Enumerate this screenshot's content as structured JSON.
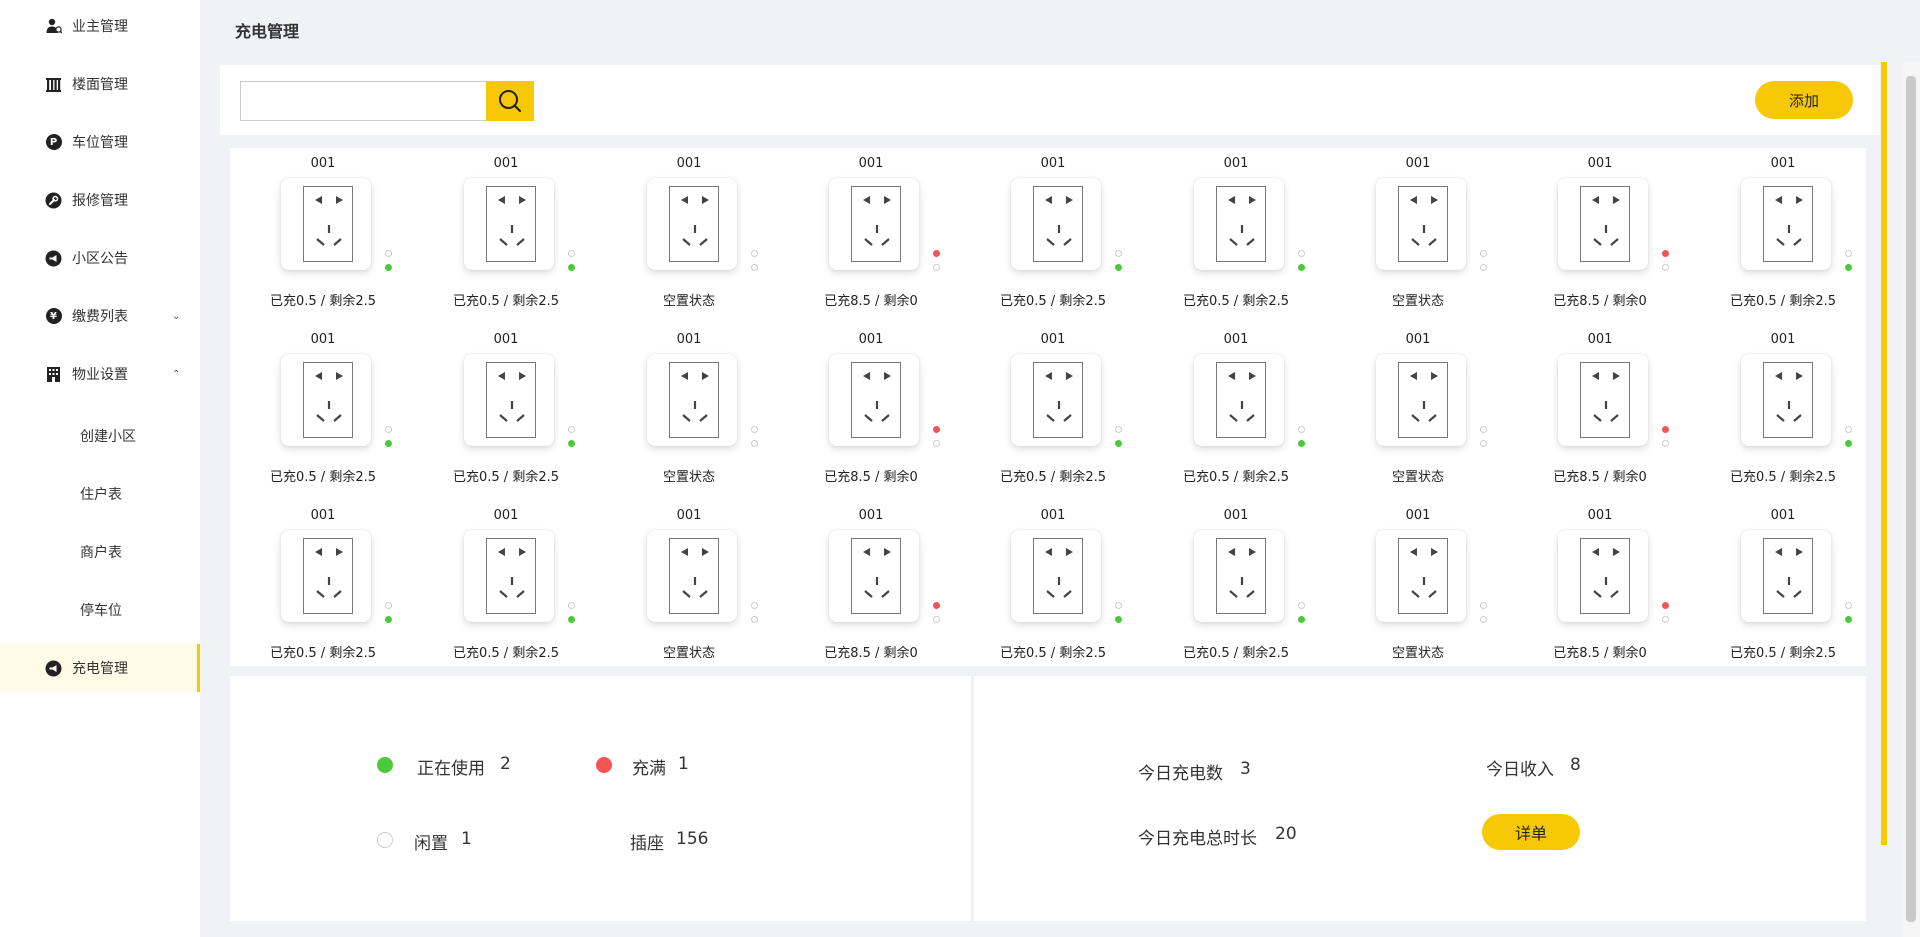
{
  "sidebar": {
    "items": [
      {
        "label": "业主管理",
        "icon": "user-icon"
      },
      {
        "label": "楼面管理",
        "icon": "building-icon"
      },
      {
        "label": "车位管理",
        "icon": "parking-icon",
        "glyph": "P"
      },
      {
        "label": "报修管理",
        "icon": "wrench-icon"
      },
      {
        "label": "小区公告",
        "icon": "megaphone-icon"
      },
      {
        "label": "缴费列表",
        "icon": "yen-icon",
        "glyph": "¥",
        "chevron": "⌄"
      },
      {
        "label": "物业设置",
        "icon": "office-icon",
        "chevron": "⌃"
      }
    ],
    "sub_items": [
      "创建小区",
      "住户表",
      "商户表",
      "停车位"
    ],
    "active": {
      "label": "充电管理",
      "icon": "megaphone-icon"
    }
  },
  "page_title": "充电管理",
  "toolbar": {
    "search_value": "",
    "add_label": "添加"
  },
  "grid": {
    "rows": [
      [
        {
          "num": "001",
          "status": "已充0.5  /  剩余2.5",
          "state": "in-use"
        },
        {
          "num": "001",
          "status": "已充0.5  /  剩余2.5",
          "state": "in-use"
        },
        {
          "num": "001",
          "status": "空置状态",
          "state": "idle"
        },
        {
          "num": "001",
          "status": "已充8.5  /  剩余0",
          "state": "full"
        },
        {
          "num": "001",
          "status": "已充0.5  /  剩余2.5",
          "state": "in-use"
        },
        {
          "num": "001",
          "status": "已充0.5  /  剩余2.5",
          "state": "in-use"
        },
        {
          "num": "001",
          "status": "空置状态",
          "state": "idle"
        },
        {
          "num": "001",
          "status": "已充8.5  /  剩余0",
          "state": "full"
        },
        {
          "num": "001",
          "status": "已充0.5  /  剩余2.5",
          "state": "in-use"
        }
      ],
      [
        {
          "num": "001",
          "status": "已充0.5  /  剩余2.5",
          "state": "in-use"
        },
        {
          "num": "001",
          "status": "已充0.5  /  剩余2.5",
          "state": "in-use"
        },
        {
          "num": "001",
          "status": "空置状态",
          "state": "idle"
        },
        {
          "num": "001",
          "status": "已充8.5  /  剩余0",
          "state": "full"
        },
        {
          "num": "001",
          "status": "已充0.5  /  剩余2.5",
          "state": "in-use"
        },
        {
          "num": "001",
          "status": "已充0.5  /  剩余2.5",
          "state": "in-use"
        },
        {
          "num": "001",
          "status": "空置状态",
          "state": "idle"
        },
        {
          "num": "001",
          "status": "已充8.5  /  剩余0",
          "state": "full"
        },
        {
          "num": "001",
          "status": "已充0.5  /  剩余2.5",
          "state": "in-use"
        }
      ],
      [
        {
          "num": "001",
          "status": "已充0.5  /  剩余2.5",
          "state": "in-use"
        },
        {
          "num": "001",
          "status": "已充0.5  /  剩余2.5",
          "state": "in-use"
        },
        {
          "num": "001",
          "status": "空置状态",
          "state": "idle"
        },
        {
          "num": "001",
          "status": "已充8.5  /  剩余0",
          "state": "full"
        },
        {
          "num": "001",
          "status": "已充0.5  /  剩余2.5",
          "state": "in-use"
        },
        {
          "num": "001",
          "status": "已充0.5  /  剩余2.5",
          "state": "in-use"
        },
        {
          "num": "001",
          "status": "空置状态",
          "state": "idle"
        },
        {
          "num": "001",
          "status": "已充8.5  /  剩余0",
          "state": "full"
        },
        {
          "num": "001",
          "status": "已充0.5  /  剩余2.5",
          "state": "in-use"
        }
      ]
    ]
  },
  "stats": {
    "in_use": {
      "label": "正在使用",
      "value": "2"
    },
    "full": {
      "label": "充满",
      "value": "1"
    },
    "idle": {
      "label": "闲置",
      "value": "1"
    },
    "sockets": {
      "label": "插座",
      "value": "156"
    },
    "today_count": {
      "label": "今日充电数",
      "value": "3"
    },
    "today_income": {
      "label": "今日收入",
      "value": "8"
    },
    "today_duration": {
      "label": "今日充电总时长",
      "value": "20"
    },
    "detail_label": "详单"
  },
  "colors": {
    "accent": "#f7c806",
    "in_use": "#4cc93a",
    "full": "#f45454",
    "idle": "#ffffff"
  }
}
